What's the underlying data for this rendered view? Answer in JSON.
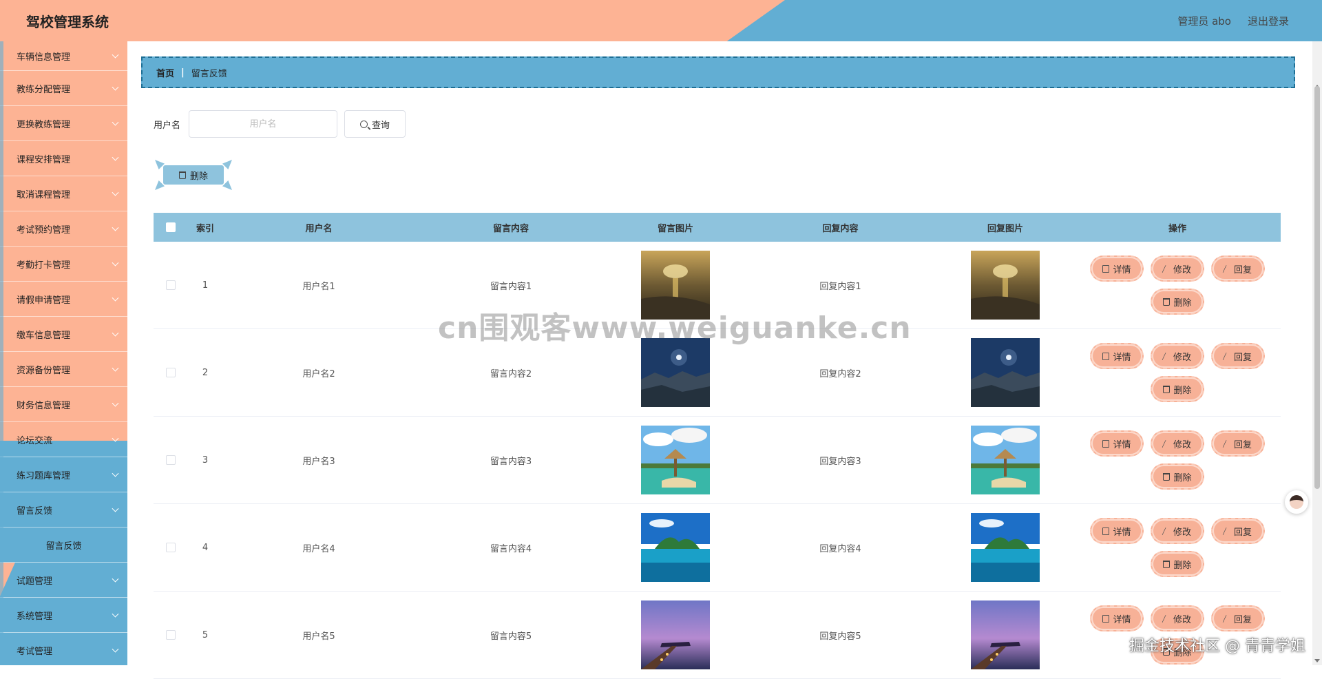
{
  "header": {
    "app_title": "驾校管理系统",
    "admin_label": "管理员 abo",
    "logout_label": "退出登录"
  },
  "sidebar": {
    "items": [
      {
        "label": "车辆信息管理"
      },
      {
        "label": "教练分配管理"
      },
      {
        "label": "更换教练管理"
      },
      {
        "label": "课程安排管理"
      },
      {
        "label": "取消课程管理"
      },
      {
        "label": "考试预约管理"
      },
      {
        "label": "考勤打卡管理"
      },
      {
        "label": "请假申请管理"
      },
      {
        "label": "缴车信息管理"
      },
      {
        "label": "资源备份管理"
      },
      {
        "label": "财务信息管理"
      },
      {
        "label": "论坛交流"
      },
      {
        "label": "练习题库管理"
      },
      {
        "label": "留言反馈"
      }
    ],
    "active_sub": "留言反馈",
    "bottom_items": [
      {
        "label": "试题管理"
      },
      {
        "label": "系统管理"
      },
      {
        "label": "考试管理"
      }
    ]
  },
  "breadcrumb": {
    "home": "首页",
    "separator": "|",
    "current": "留言反馈"
  },
  "search": {
    "label": "用户名",
    "placeholder": "用户名",
    "button": "查询"
  },
  "actions": {
    "batch_delete": "删除"
  },
  "table": {
    "headers": [
      "索引",
      "用户名",
      "留言内容",
      "留言图片",
      "回复内容",
      "回复图片",
      "操作"
    ],
    "rows": [
      {
        "index": "1",
        "user": "用户名1",
        "message": "留言内容1",
        "reply": "回复内容1",
        "image": "sunset-beach"
      },
      {
        "index": "2",
        "user": "用户名2",
        "message": "留言内容2",
        "reply": "回复内容2",
        "image": "night-cliffs"
      },
      {
        "index": "3",
        "user": "用户名3",
        "message": "留言内容3",
        "reply": "回复内容3",
        "image": "tropical-hut"
      },
      {
        "index": "4",
        "user": "用户名4",
        "message": "留言内容4",
        "reply": "回复内容4",
        "image": "island-lagoon"
      },
      {
        "index": "5",
        "user": "用户名5",
        "message": "留言内容5",
        "reply": "回复内容5",
        "image": "pier-dusk"
      }
    ],
    "op_labels": {
      "detail": "详情",
      "edit": "修改",
      "reply": "回复",
      "delete": "删除"
    }
  },
  "overlay": {
    "watermark": "cn围观客www.weiguanke.cn",
    "footer": "掘金技术社区 @ 青青学姐"
  },
  "colors": {
    "accent_orange": "#fdb394",
    "accent_blue": "#62aed3",
    "table_header": "#8ec3dd"
  }
}
